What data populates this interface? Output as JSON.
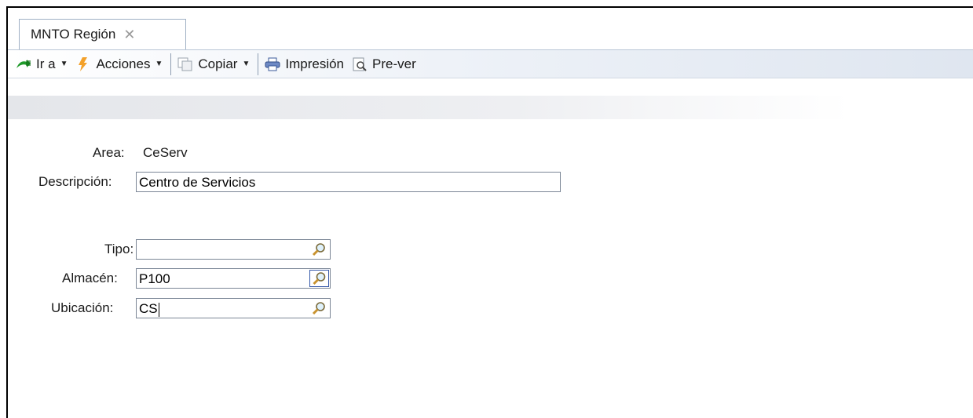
{
  "tab": {
    "title": "MNTO Región",
    "close_glyph": "✕"
  },
  "toolbar": {
    "items": [
      {
        "icon": "go-arrow-icon",
        "label": "Ir a",
        "dropdown": true
      },
      {
        "icon": "lightning-icon",
        "label": "Acciones",
        "dropdown": true
      },
      {
        "icon": "copy-icon",
        "label": "Copiar",
        "dropdown": true
      },
      {
        "icon": "printer-icon",
        "label": "Impresión",
        "dropdown": false
      },
      {
        "icon": "preview-icon",
        "label": "Pre-ver",
        "dropdown": false
      }
    ]
  },
  "form": {
    "area_label": "Area:",
    "area_value": "CeServ",
    "descripcion_label": "Descripción:",
    "descripcion_value": "Centro de Servicios",
    "tipo_label": "Tipo:",
    "tipo_value": "",
    "almacen_label": "Almacén:",
    "almacen_value": "P100",
    "ubicacion_label": "Ubicación:",
    "ubicacion_value": "CS"
  },
  "icons": {
    "lookup": "magnifier-icon"
  },
  "colors": {
    "accent": "#3558a8",
    "border": "#7b8696"
  }
}
